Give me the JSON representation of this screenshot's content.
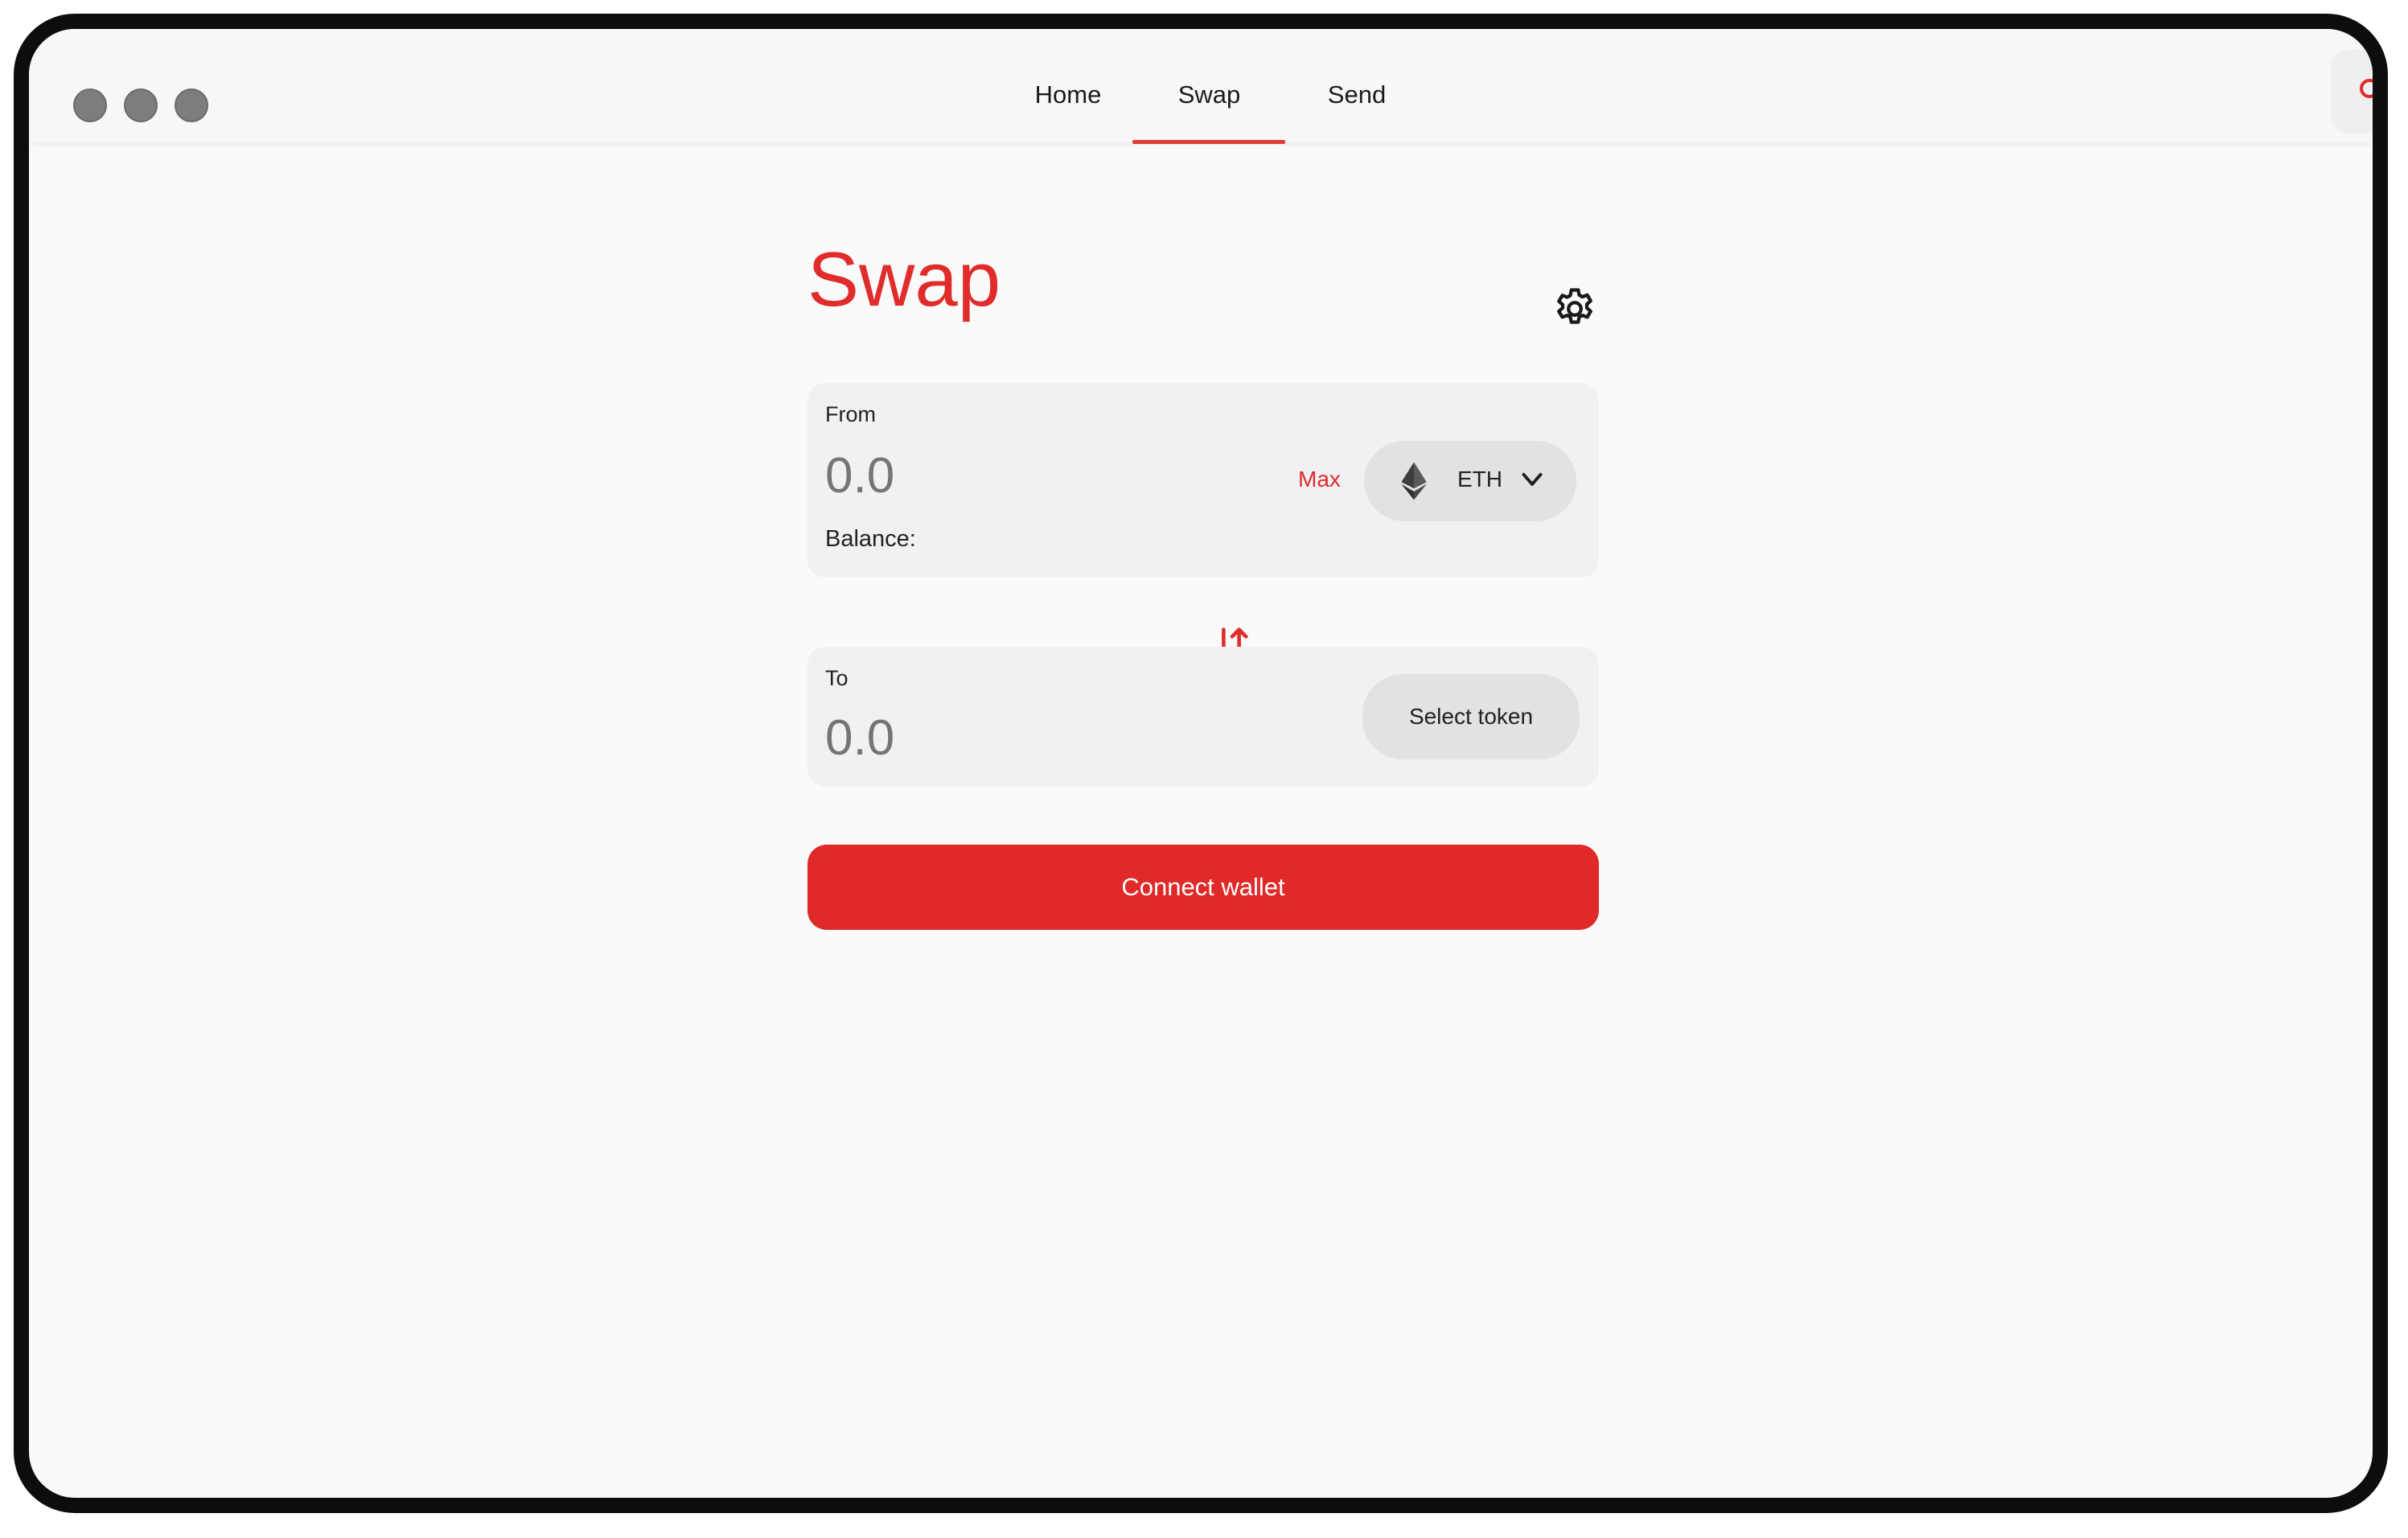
{
  "window": {
    "controls": [
      "window-dot",
      "window-dot",
      "window-dot"
    ]
  },
  "nav": {
    "tabs": [
      {
        "label": "Home"
      },
      {
        "label": "Swap"
      },
      {
        "label": "Send"
      }
    ],
    "active_tab": "Swap"
  },
  "swap": {
    "title": "Swap",
    "settings_icon": "gear-icon",
    "swap_direction_icon": "swap-arrows-icon",
    "from": {
      "label": "From",
      "amount_placeholder": "0.0",
      "max_label": "Max",
      "token": "ETH",
      "token_icon": "ethereum-icon",
      "balance_label": "Balance:"
    },
    "to": {
      "label": "To",
      "amount_placeholder": "0.0",
      "select_label": "Select token"
    },
    "connect_label": "Connect wallet"
  },
  "colors": {
    "accent": "#e02c2b",
    "panel": "#f1f1f4",
    "placeholder": "#8b8ea3",
    "pill": "#e2e2e5"
  }
}
